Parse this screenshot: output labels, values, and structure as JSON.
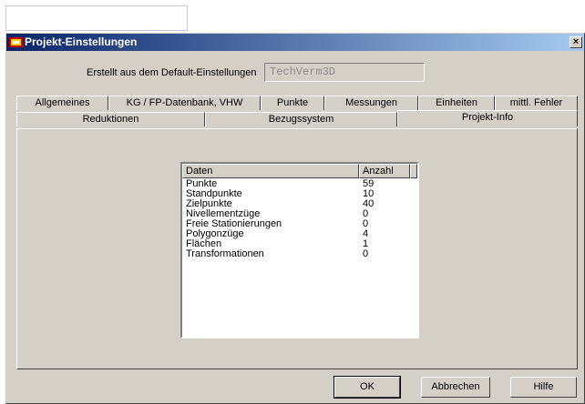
{
  "dialog": {
    "title": "Projekt-Einstellungen",
    "close_symbol": "×"
  },
  "source": {
    "label": "Erstellt aus dem Default-Einstellungen",
    "value": "TechVerm3D"
  },
  "tabs_row1": [
    {
      "label": "Allgemeines"
    },
    {
      "label": "KG / FP-Datenbank, VHW"
    },
    {
      "label": "Punkte"
    },
    {
      "label": "Messungen"
    },
    {
      "label": "Einheiten"
    },
    {
      "label": "mittl. Fehler"
    }
  ],
  "tabs_row2": [
    {
      "label": "Reduktionen"
    },
    {
      "label": "Bezugssystem"
    },
    {
      "label": "Projekt-Info",
      "active": true
    }
  ],
  "info_table": {
    "columns": [
      "Daten",
      "Anzahl"
    ],
    "rows": [
      {
        "name": "Punkte",
        "count": "59"
      },
      {
        "name": "Standpunkte",
        "count": "10"
      },
      {
        "name": "Zielpunkte",
        "count": "40"
      },
      {
        "name": "Nivellementzüge",
        "count": "0"
      },
      {
        "name": "Freie Stationierungen",
        "count": "0"
      },
      {
        "name": "Polygonzüge",
        "count": "4"
      },
      {
        "name": "Flächen",
        "count": "1"
      },
      {
        "name": "Transformationen",
        "count": "0"
      }
    ]
  },
  "buttons": {
    "ok": "OK",
    "cancel": "Abbrechen",
    "help": "Hilfe"
  }
}
